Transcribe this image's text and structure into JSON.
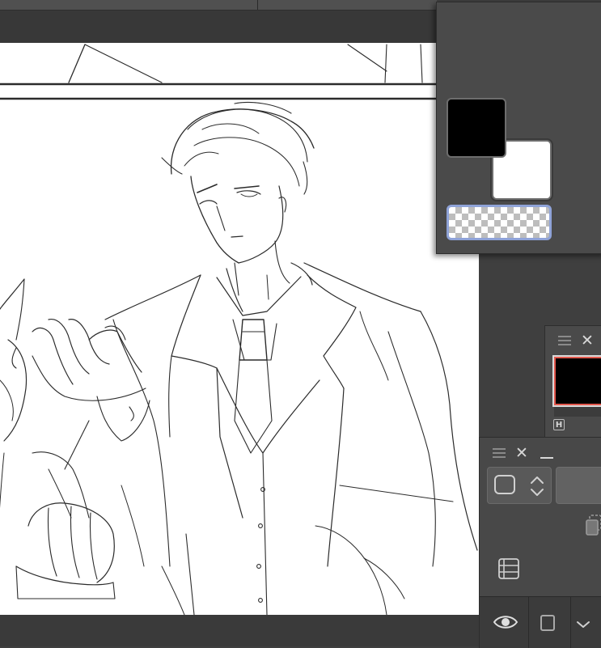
{
  "colors": {
    "main_color": "#000000",
    "sub_color": "#ffffff",
    "history_selected": "#000000",
    "accent_selected": "#8fa3d8",
    "accent_history": "#e2574c"
  },
  "icons": {
    "panel_grip": "hamburger-icon",
    "panel_close": "close-icon",
    "panel_minimize": "minimize-icon",
    "blend_mode": "rounded-square-icon",
    "spinner": "chevron-up-down-icon",
    "copy": "copy-icon",
    "layer_list": "list-icon",
    "visibility": "eye-icon",
    "lock": "square-icon",
    "dropdown": "chevron-down-icon"
  },
  "history_panel": {
    "badge": "H"
  }
}
